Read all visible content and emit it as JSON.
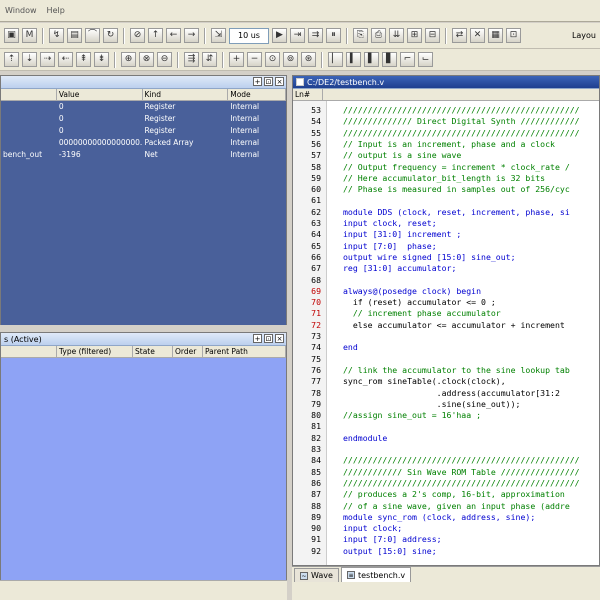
{
  "menubar": {
    "items": [
      "Window",
      "Help"
    ]
  },
  "toolbar": {
    "time_value": "10 us",
    "layout_label": "Layou"
  },
  "objects_pane": {
    "columns": [
      "",
      "Value",
      "Kind",
      "Mode"
    ],
    "rows": [
      {
        "name": "",
        "value": "0",
        "kind": "Register",
        "mode": "Internal"
      },
      {
        "name": "",
        "value": "0",
        "kind": "Register",
        "mode": "Internal"
      },
      {
        "name": "",
        "value": "0",
        "kind": "Register",
        "mode": "Internal"
      },
      {
        "name": "",
        "value": "00000000000000000...",
        "kind": "Packed Array",
        "mode": "Internal"
      },
      {
        "name": "bench_out",
        "value": "-3196",
        "kind": "Net",
        "mode": "Internal"
      }
    ]
  },
  "processes_pane": {
    "title": "s (Active)",
    "columns": [
      "",
      "Type (filtered)",
      "State",
      "Order",
      "Parent Path"
    ]
  },
  "source_pane": {
    "title": "C:/DE2/testbench.v",
    "ln_header": "Ln#",
    "lines": [
      {
        "n": "53",
        "t": "////////////////////////////////////////////////",
        "c": "cm"
      },
      {
        "n": "54",
        "t": "////////////// Direct Digital Synth ////////////",
        "c": "cm"
      },
      {
        "n": "55",
        "t": "////////////////////////////////////////////////",
        "c": "cm"
      },
      {
        "n": "56",
        "t": "// Input is an increment, phase and a clock",
        "c": "cm"
      },
      {
        "n": "57",
        "t": "// output is a sine wave",
        "c": "cm"
      },
      {
        "n": "58",
        "t": "// Output frequency = increment * clock_rate /",
        "c": "cm"
      },
      {
        "n": "59",
        "t": "// Here accumulator_bit_length is 32 bits",
        "c": "cm"
      },
      {
        "n": "60",
        "t": "// Phase is measured in samples out of 256/cyc",
        "c": "cm"
      },
      {
        "n": "61",
        "t": "",
        "c": "plain"
      },
      {
        "n": "62",
        "t": "module DDS (clock, reset, increment, phase, si",
        "c": "kw"
      },
      {
        "n": "63",
        "t": "input clock, reset;",
        "c": "kw"
      },
      {
        "n": "64",
        "t": "input [31:0] increment ;",
        "c": "kw"
      },
      {
        "n": "65",
        "t": "input [7:0]  phase;",
        "c": "kw"
      },
      {
        "n": "66",
        "t": "output wire signed [15:0] sine_out;",
        "c": "kw"
      },
      {
        "n": "67",
        "t": "reg [31:0] accumulator;",
        "c": "kw"
      },
      {
        "n": "68",
        "t": "",
        "c": "plain"
      },
      {
        "n": "69",
        "t": "always@(posedge clock) begin",
        "c": "kw",
        "red": true
      },
      {
        "n": "70",
        "t": "  if (reset) accumulator <= 0 ;",
        "c": "plain",
        "red": true
      },
      {
        "n": "71",
        "t": "  // increment phase accumulator",
        "c": "cm",
        "red": true
      },
      {
        "n": "72",
        "t": "  else accumulator <= accumulator + increment",
        "c": "plain",
        "red": true
      },
      {
        "n": "73",
        "t": "",
        "c": "plain"
      },
      {
        "n": "74",
        "t": "end",
        "c": "kw"
      },
      {
        "n": "75",
        "t": "",
        "c": "plain"
      },
      {
        "n": "76",
        "t": "// link the accumulator to the sine lookup tab",
        "c": "cm"
      },
      {
        "n": "77",
        "t": "sync_rom sineTable(.clock(clock),",
        "c": "plain"
      },
      {
        "n": "78",
        "t": "                   .address(accumulator[31:2",
        "c": "plain"
      },
      {
        "n": "79",
        "t": "                   .sine(sine_out));",
        "c": "plain"
      },
      {
        "n": "80",
        "t": "//assign sine_out = 16'haa ;",
        "c": "cm"
      },
      {
        "n": "81",
        "t": "",
        "c": "plain"
      },
      {
        "n": "82",
        "t": "endmodule",
        "c": "kw"
      },
      {
        "n": "83",
        "t": "",
        "c": "plain"
      },
      {
        "n": "84",
        "t": "////////////////////////////////////////////////",
        "c": "cm"
      },
      {
        "n": "85",
        "t": "//////////// Sin Wave ROM Table ////////////////",
        "c": "cm"
      },
      {
        "n": "86",
        "t": "////////////////////////////////////////////////",
        "c": "cm"
      },
      {
        "n": "87",
        "t": "// produces a 2's comp, 16-bit, approximation",
        "c": "cm"
      },
      {
        "n": "88",
        "t": "// of a sine wave, given an input phase (addre",
        "c": "cm"
      },
      {
        "n": "89",
        "t": "module sync_rom (clock, address, sine);",
        "c": "kw"
      },
      {
        "n": "90",
        "t": "input clock;",
        "c": "kw"
      },
      {
        "n": "91",
        "t": "input [7:0] address;",
        "c": "kw"
      },
      {
        "n": "92",
        "t": "output [15:0] sine;",
        "c": "kw"
      }
    ]
  },
  "tabs": [
    {
      "label": "Wave",
      "active": false
    },
    {
      "label": "testbench.v",
      "active": true
    }
  ]
}
